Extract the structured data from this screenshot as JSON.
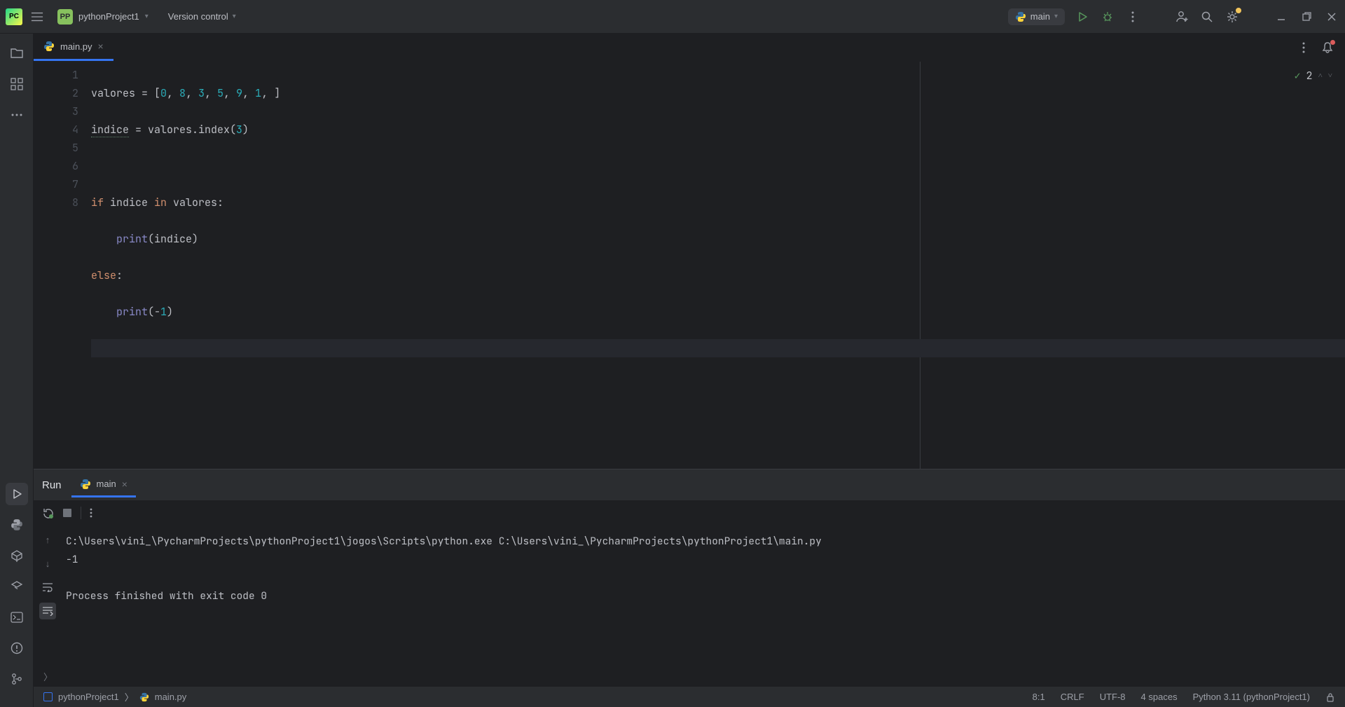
{
  "top": {
    "project_name": "pythonProject1",
    "version_control_label": "Version control",
    "run_config_label": "main"
  },
  "editor": {
    "tab_filename": "main.py",
    "inspection": {
      "count": "2"
    },
    "lines": [
      "1",
      "2",
      "3",
      "4",
      "5",
      "6",
      "7",
      "8"
    ],
    "code": {
      "l1_a": "valores = [",
      "l1_vals": [
        "0",
        "8",
        "3",
        "5",
        "9",
        "1"
      ],
      "l1_b": ", ]",
      "l2_a": "indice",
      "l2_b": " = valores.index(",
      "l2_c": "3",
      "l2_d": ")",
      "l4_a": "if ",
      "l4_b": "indice ",
      "l4_c": "in ",
      "l4_d": "valores:",
      "l5_a": "    print",
      "l5_b": "(indice)",
      "l6_a": "else",
      "l6_b": ":",
      "l7_a": "    print",
      "l7_b": "(-",
      "l7_c": "1",
      "l7_d": ")"
    }
  },
  "run": {
    "title": "Run",
    "subtab_label": "main",
    "output_cmd": "C:\\Users\\vini_\\PycharmProjects\\pythonProject1\\jogos\\Scripts\\python.exe C:\\Users\\vini_\\PycharmProjects\\pythonProject1\\main.py",
    "output_result": "-1",
    "output_exit": "Process finished with exit code 0"
  },
  "status": {
    "breadcrumb_project": "pythonProject1",
    "breadcrumb_file": "main.py",
    "cursor": "8:1",
    "line_sep": "CRLF",
    "encoding": "UTF-8",
    "indent": "4 spaces",
    "interpreter": "Python 3.11 (pythonProject1)"
  }
}
